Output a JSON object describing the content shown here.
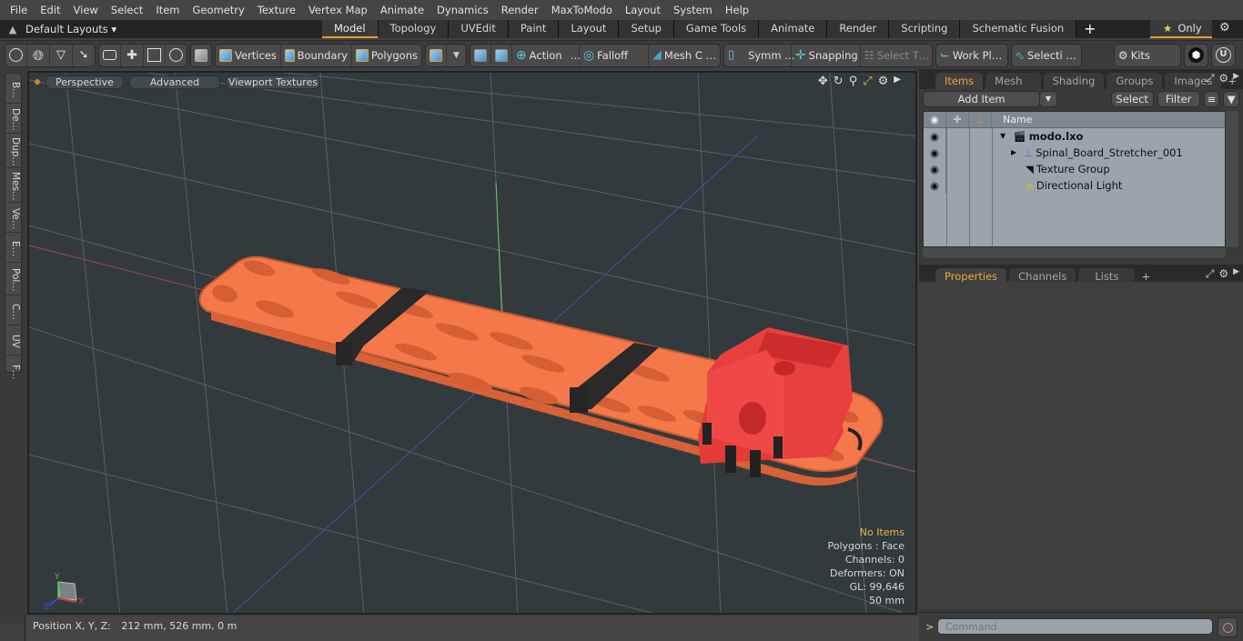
{
  "menu": [
    "File",
    "Edit",
    "View",
    "Select",
    "Item",
    "Geometry",
    "Texture",
    "Vertex Map",
    "Animate",
    "Dynamics",
    "Render",
    "MaxToModo",
    "Layout",
    "System",
    "Help"
  ],
  "layoutbar": {
    "layouts_label": "Default Layouts ▾",
    "tabs": [
      "Model",
      "Topology",
      "UVEdit",
      "Paint",
      "Layout",
      "Setup",
      "Game Tools",
      "Animate",
      "Render",
      "Scripting",
      "Schematic Fusion"
    ],
    "active_tab": "Model",
    "add_tab": "+",
    "only_label": "Only",
    "accent": "#e89b2c"
  },
  "toolbar": {
    "vertices": "Vertices",
    "boundary": "Boundary",
    "polygons": "Polygons",
    "action": "Action",
    "falloff": "Falloff",
    "mesh": "Mesh C …",
    "symmetry": "Symm …",
    "snapping": "Snapping",
    "select_t": "Select T…",
    "workplane": "Work Pl…",
    "selection": "Selecti …",
    "kits": "Kits",
    "ellipsis": "…"
  },
  "lefttabs": [
    "B…",
    "De…",
    "Dup…",
    "Mes…",
    "Ve…",
    "E…",
    "Pol…",
    "C…",
    "UV",
    "F…"
  ],
  "viewport": {
    "buttons": [
      "Perspective",
      "Advanced",
      "Viewport Textures"
    ],
    "hud": {
      "selection": "No Items",
      "polygons": "Polygons : Face",
      "channels": "Channels: 0",
      "deformers": "Deformers: ON",
      "gl": "GL: 99,646",
      "scale": "50 mm"
    },
    "axis_labels": {
      "y": "Y",
      "x": "X",
      "z": "Z"
    }
  },
  "status": {
    "label": "Position X, Y, Z:",
    "value": "212 mm, 526 mm, 0 m"
  },
  "items_panel": {
    "tabs": [
      "Items",
      "Mesh …",
      "Shading",
      "Groups",
      "Images"
    ],
    "active_tab": "Items",
    "add_item": "Add Item",
    "select": "Select",
    "filter": "Filter",
    "name_header": "Name",
    "tree": [
      {
        "name": "modo.lxo",
        "bold": true,
        "icon": "scene-icon"
      },
      {
        "name": "Spinal_Board_Stretcher_001",
        "icon": "mesh-locator-icon"
      },
      {
        "name": "Texture Group",
        "icon": "texture-group-icon"
      },
      {
        "name": "Directional Light",
        "icon": "light-icon"
      }
    ]
  },
  "props_panel": {
    "tabs": [
      "Properties",
      "Channels",
      "Lists"
    ],
    "active_tab": "Properties"
  },
  "command": {
    "prompt": ">",
    "placeholder": "Command"
  }
}
